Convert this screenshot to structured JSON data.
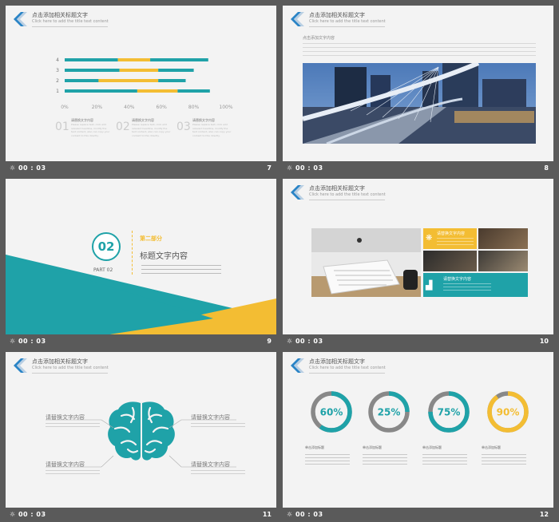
{
  "slides": [
    {
      "num": "7",
      "time": "00 : 03",
      "title": "点击添加相关标题文字",
      "subtitle": "Click here to add the title text content"
    },
    {
      "num": "8",
      "time": "00 : 03",
      "title": "点击添加相关标题文字",
      "subtitle": "Click here to add the title text content"
    },
    {
      "num": "9",
      "time": "00 : 03"
    },
    {
      "num": "10",
      "time": "00 : 03",
      "title": "点击添加相关标题文字",
      "subtitle": "Click here to add the title text content"
    },
    {
      "num": "11",
      "time": "00 : 03",
      "title": "点击添加相关标题文字",
      "subtitle": "Click here to add the title text content"
    },
    {
      "num": "12",
      "time": "00 : 03",
      "title": "点击添加相关标题文字",
      "subtitle": "Click here to add the title text content"
    }
  ],
  "chart_data": {
    "type": "bar",
    "orientation": "horizontal",
    "categories": [
      "1",
      "2",
      "3",
      "4"
    ],
    "series": [
      {
        "values": [
          45,
          21,
          34,
          33
        ],
        "color": "#1fa2a8"
      },
      {
        "values": [
          25,
          37,
          24,
          20
        ],
        "color": "#f3bd33"
      },
      {
        "values": [
          20,
          17,
          22,
          36
        ],
        "color": "#1fa2a8"
      }
    ],
    "xticks": [
      "0%",
      "20%",
      "40%",
      "60%",
      "80%",
      "100%"
    ],
    "xlim": [
      0,
      100
    ]
  },
  "s7": {
    "items": [
      {
        "n": "01",
        "t": "请替换文字内容"
      },
      {
        "n": "02",
        "t": "请替换文字内容"
      },
      {
        "n": "03",
        "t": "请替换文字内容"
      }
    ]
  },
  "s8": {
    "caption": "点击添加文字内容"
  },
  "s9": {
    "badge": "02",
    "part": "PART 02",
    "heading": "第二部分",
    "title": "标题文字内容"
  },
  "s10": {
    "box1": "请替换文字内容",
    "box2": "请替换文字内容"
  },
  "s11": {
    "labels": [
      "请替换文字内容",
      "请替换文字内容",
      "请替换文字内容",
      "请替换文字内容"
    ]
  },
  "s12": {
    "donuts": [
      {
        "label": "60%",
        "value": 60,
        "color": "#1fa2a8"
      },
      {
        "label": "25%",
        "value": 25,
        "color": "#1fa2a8"
      },
      {
        "label": "75%",
        "value": 75,
        "color": "#1fa2a8"
      },
      {
        "label": "90%",
        "value": 90,
        "color": "#f3bd33"
      }
    ],
    "caption": "单击添加标题"
  }
}
